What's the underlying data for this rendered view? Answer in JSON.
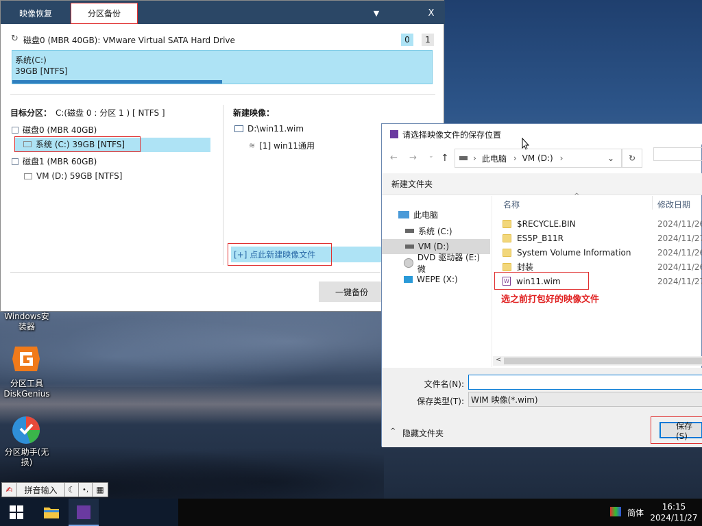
{
  "main_window": {
    "tabs": [
      "映像恢复",
      "分区备份"
    ],
    "minimize_glyph": "▼",
    "close_glyph": "X",
    "disk_header": "磁盘0 (MBR 40GB): VMware Virtual SATA Hard Drive",
    "disk_numbers": [
      "0",
      "1"
    ],
    "partition_name": "系统(C:)",
    "partition_size": "39GB [NTFS]",
    "partition_used_fraction": 0.5,
    "target_label": "目标分区：",
    "target_value": "C:(磁盘 0 : 分区 1 ) [ NTFS ]",
    "tree": [
      {
        "label": "磁盘0 (MBR 40GB)",
        "type": "disk"
      },
      {
        "label": "系统 (C:) 39GB [NTFS]",
        "type": "partition",
        "selected": true
      },
      {
        "label": "磁盘1 (MBR 60GB)",
        "type": "disk"
      },
      {
        "label": "VM (D:) 59GB [NTFS]",
        "type": "partition"
      }
    ],
    "new_image_label": "新建映像：",
    "image_path": "D:\\win11.wim",
    "image_entry": "[1] win11通用",
    "add_image_link": "[+] 点此新建映像文件",
    "backup_button": "一键备份"
  },
  "dialog": {
    "title": "请选择映像文件的保存位置",
    "breadcrumb": [
      "此电脑",
      "VM (D:)"
    ],
    "new_folder": "新建文件夹",
    "nav_items": [
      {
        "label": "此电脑",
        "icon": "computer-icon"
      },
      {
        "label": "系统 (C:)",
        "icon": "drive-icon"
      },
      {
        "label": "VM (D:)",
        "icon": "drive-icon",
        "selected": true
      },
      {
        "label": "DVD 驱动器 (E:) 微",
        "icon": "dvd-icon"
      },
      {
        "label": "WEPE (X:)",
        "icon": "usb-drive-icon"
      }
    ],
    "columns": {
      "name": "名称",
      "modified": "修改日期"
    },
    "files": [
      {
        "name": "$RECYCLE.BIN",
        "date": "2024/11/26",
        "type": "folder"
      },
      {
        "name": "ES5P_B11R",
        "date": "2024/11/27",
        "type": "folder"
      },
      {
        "name": "System Volume Information",
        "date": "2024/11/26",
        "type": "folder"
      },
      {
        "name": "封装",
        "date": "2024/11/26",
        "type": "folder"
      },
      {
        "name": "win11.wim",
        "date": "2024/11/27",
        "type": "wim"
      }
    ],
    "annotation": "选之前打包好的映像文件",
    "filename_label": "文件名(N):",
    "filename_value": "",
    "filetype_label": "保存类型(T):",
    "filetype_value": "WIM 映像(*.wim)",
    "hide_folders": "隐藏文件夹",
    "save_button": "保存(S)"
  },
  "desktop_icons": [
    {
      "label": "Windows安装器"
    },
    {
      "label": "分区工具DiskGenius"
    },
    {
      "label": "分区助手(无损)"
    }
  ],
  "ime": {
    "label": "拼音输入"
  },
  "taskbar": {
    "lang": "简体",
    "time": "16:15",
    "date": "2024/11/27"
  },
  "colors": {
    "accent": "#0078d7",
    "highlight": "#aee3f5",
    "annotation_red": "#e02020",
    "tabbar": "#2b4766"
  }
}
